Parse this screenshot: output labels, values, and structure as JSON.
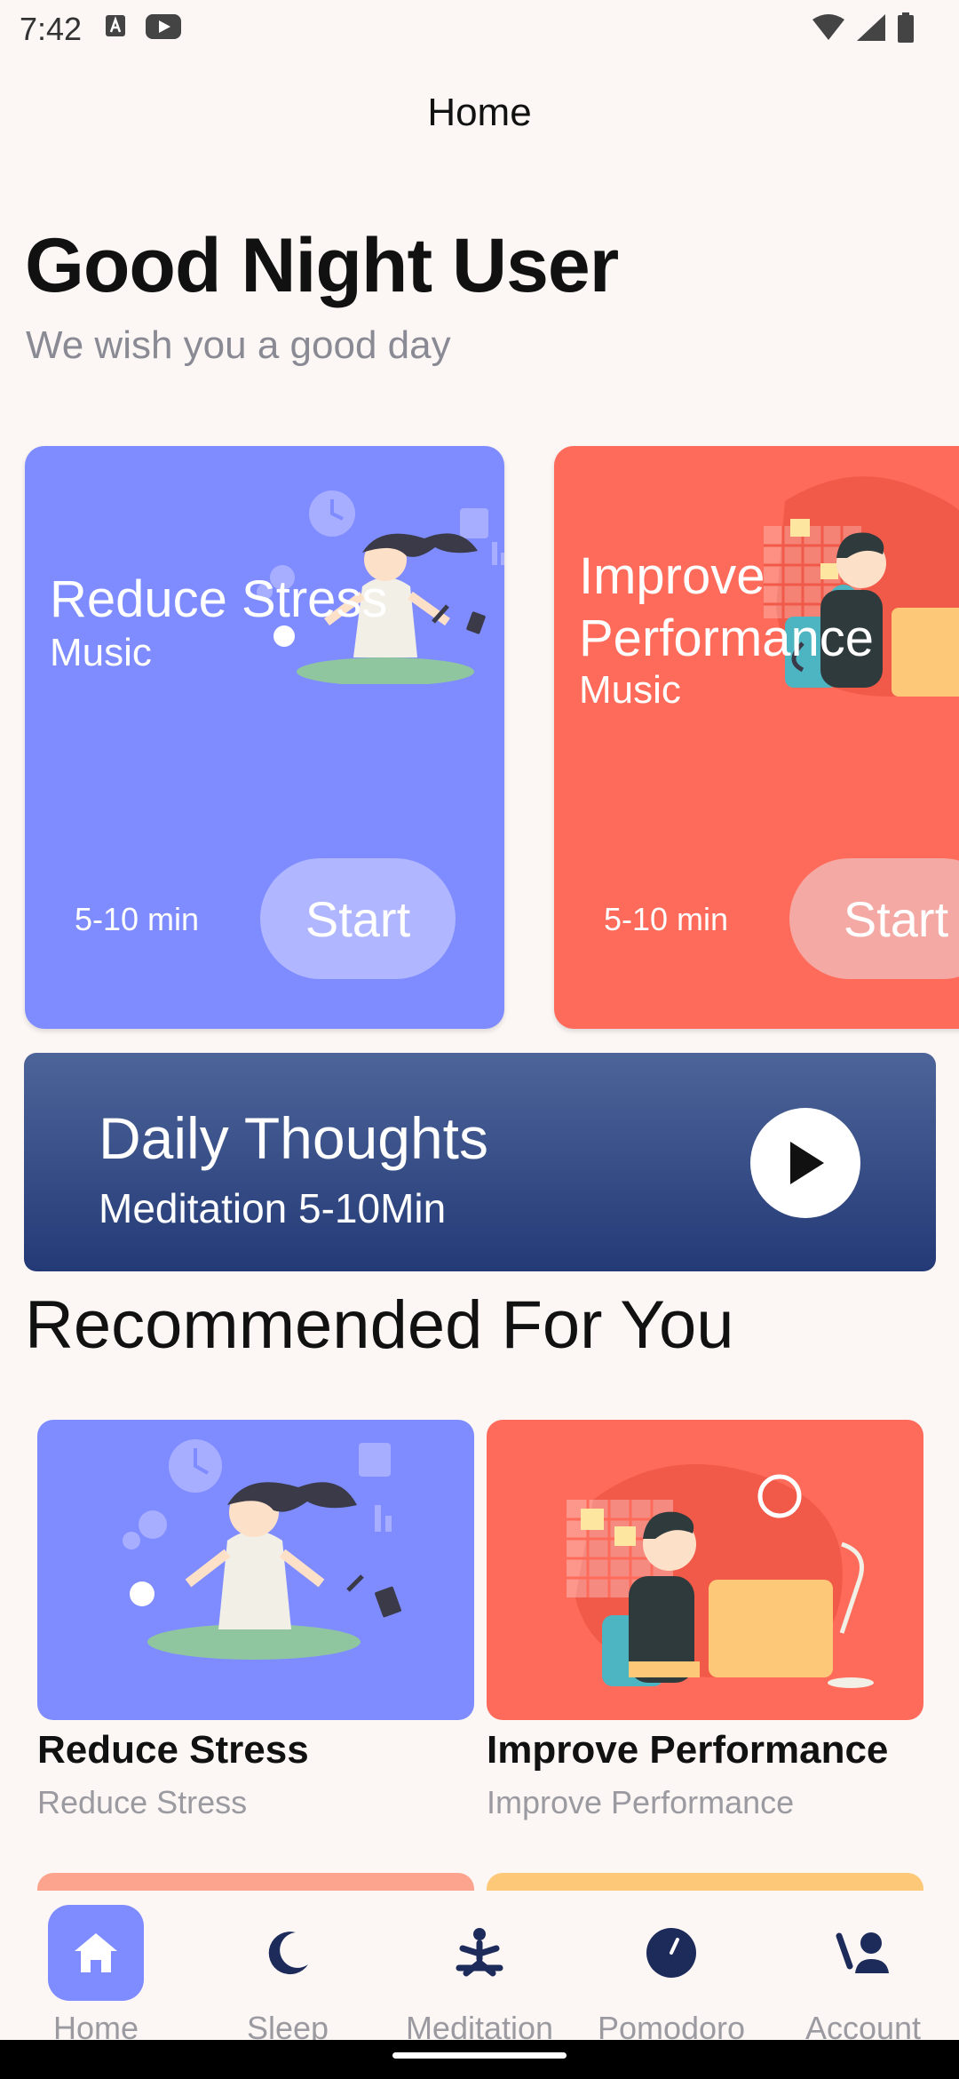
{
  "status_bar": {
    "time": "7:42"
  },
  "header": {
    "title": "Home"
  },
  "greeting": {
    "title": "Good Night User",
    "subtitle": "We wish you a good day"
  },
  "featured_cards": [
    {
      "title": "Reduce Stress",
      "subtitle": "Music",
      "duration": "5-10 min",
      "button": "Start",
      "color": "#7f8cff"
    },
    {
      "title_line1": "Improve",
      "title_line2": "Performance",
      "subtitle": "Music",
      "duration": "5-10 min",
      "button": "Start",
      "color": "#fe6b5a"
    }
  ],
  "daily": {
    "title": "Daily Thoughts",
    "subtitle": "Meditation 5-10Min"
  },
  "recommended": {
    "title": "Recommended For You",
    "items": [
      {
        "name": "Reduce Stress",
        "subtitle": "Reduce Stress"
      },
      {
        "name": "Improve Performance",
        "subtitle": "Improve Performance"
      }
    ]
  },
  "bottom_nav": [
    {
      "label": "Home",
      "icon": "home-icon",
      "active": true
    },
    {
      "label": "Sleep",
      "icon": "moon-icon"
    },
    {
      "label": "Meditation",
      "icon": "meditation-icon"
    },
    {
      "label": "Pomodoro",
      "icon": "timer-icon"
    },
    {
      "label": "Account",
      "icon": "account-icon"
    }
  ],
  "colors": {
    "accent": "#7f8cff",
    "red": "#fe6b5a",
    "navy": "#243a77"
  }
}
